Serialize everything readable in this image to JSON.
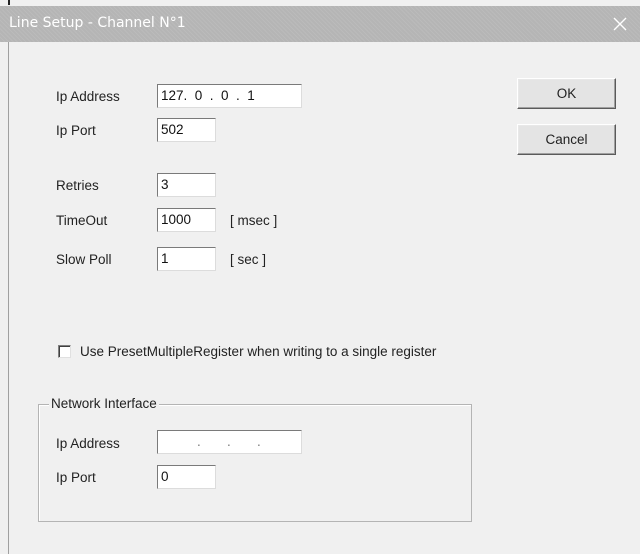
{
  "window": {
    "title": "Line Setup - Channel N°1",
    "close_glyph": "✕",
    "titlebar_color": "#b5b5b5"
  },
  "form": {
    "ip_address_label": "Ip Address",
    "ip_address_value": "127.  0  .  0  .  1",
    "ip_port_label": "Ip Port",
    "ip_port_value": "502",
    "retries_label": "Retries",
    "retries_value": "3",
    "timeout_label": "TimeOut",
    "timeout_value": "1000",
    "timeout_unit": "[ msec ]",
    "slowpoll_label": "Slow Poll",
    "slowpoll_value": "1",
    "slowpoll_unit": "[ sec ]"
  },
  "buttons": {
    "ok_label": "OK",
    "cancel_label": "Cancel"
  },
  "options": {
    "preset_label": "Use PresetMultipleRegister when writing to a single register",
    "preset_checked": false
  },
  "network": {
    "group_label": "Network Interface",
    "ip_address_label": "Ip Address",
    "ip_address_value": ".       .       .",
    "ip_port_label": "Ip Port",
    "ip_port_value": "0"
  }
}
